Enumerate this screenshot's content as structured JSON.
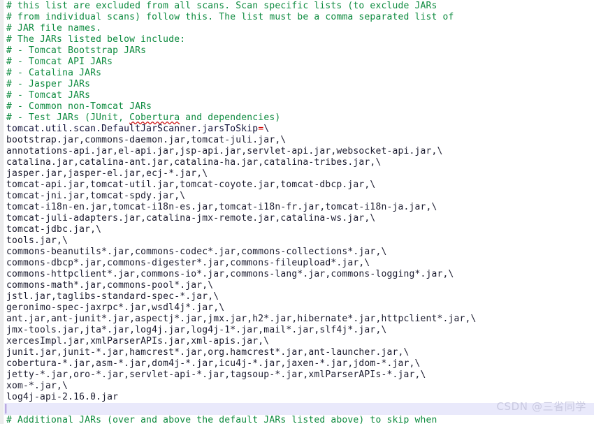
{
  "editor": {
    "file_type": "properties",
    "colors": {
      "background": "#ffffff",
      "gutter": "#ececed",
      "comment": "#0c8a3e",
      "text": "#101038",
      "operator": "#cc0000",
      "current_line": "#e9e9fb",
      "caret": "#6a3fb5",
      "spellcheck_underline": "#d01a1a",
      "watermark": "#c9c9e0"
    }
  },
  "watermark": {
    "text": "CSDN @三省同学"
  },
  "lines": [
    {
      "kind": "comment",
      "text": "# this list are excluded from all scans. Scan specific lists (to exclude JARs"
    },
    {
      "kind": "comment",
      "text": "# from individual scans) follow this. The list must be a comma separated list of"
    },
    {
      "kind": "comment",
      "text": "# JAR file names."
    },
    {
      "kind": "comment",
      "text": "# The JARs listed below include:"
    },
    {
      "kind": "comment",
      "text": "# - Tomcat Bootstrap JARs"
    },
    {
      "kind": "comment",
      "text": "# - Tomcat API JARs"
    },
    {
      "kind": "comment",
      "text": "# - Catalina JARs"
    },
    {
      "kind": "comment",
      "text": "# - Jasper JARs"
    },
    {
      "kind": "comment",
      "text": "# - Tomcat JARs"
    },
    {
      "kind": "comment",
      "text": "# - Common non-Tomcat JARs"
    },
    {
      "kind": "comment-spell",
      "pre": "# - Test JARs (JUnit, ",
      "spell": "Cobertura",
      "post": " and dependencies)"
    },
    {
      "kind": "key",
      "name": "tomcat.util.scan.DefaultJarScanner.jarsToSkip",
      "eq": "=",
      "cont": "\\"
    },
    {
      "kind": "value",
      "text": "bootstrap.jar,commons-daemon.jar,tomcat-juli.jar,\\"
    },
    {
      "kind": "value",
      "text": "annotations-api.jar,el-api.jar,jsp-api.jar,servlet-api.jar,websocket-api.jar,\\"
    },
    {
      "kind": "value",
      "text": "catalina.jar,catalina-ant.jar,catalina-ha.jar,catalina-tribes.jar,\\"
    },
    {
      "kind": "value",
      "text": "jasper.jar,jasper-el.jar,ecj-*.jar,\\"
    },
    {
      "kind": "value",
      "text": "tomcat-api.jar,tomcat-util.jar,tomcat-coyote.jar,tomcat-dbcp.jar,\\"
    },
    {
      "kind": "value",
      "text": "tomcat-jni.jar,tomcat-spdy.jar,\\"
    },
    {
      "kind": "value",
      "text": "tomcat-i18n-en.jar,tomcat-i18n-es.jar,tomcat-i18n-fr.jar,tomcat-i18n-ja.jar,\\"
    },
    {
      "kind": "value",
      "text": "tomcat-juli-adapters.jar,catalina-jmx-remote.jar,catalina-ws.jar,\\"
    },
    {
      "kind": "value",
      "text": "tomcat-jdbc.jar,\\"
    },
    {
      "kind": "value",
      "text": "tools.jar,\\"
    },
    {
      "kind": "value",
      "text": "commons-beanutils*.jar,commons-codec*.jar,commons-collections*.jar,\\"
    },
    {
      "kind": "value",
      "text": "commons-dbcp*.jar,commons-digester*.jar,commons-fileupload*.jar,\\"
    },
    {
      "kind": "value",
      "text": "commons-httpclient*.jar,commons-io*.jar,commons-lang*.jar,commons-logging*.jar,\\"
    },
    {
      "kind": "value",
      "text": "commons-math*.jar,commons-pool*.jar,\\"
    },
    {
      "kind": "value",
      "text": "jstl.jar,taglibs-standard-spec-*.jar,\\"
    },
    {
      "kind": "value",
      "text": "geronimo-spec-jaxrpc*.jar,wsdl4j*.jar,\\"
    },
    {
      "kind": "value",
      "text": "ant.jar,ant-junit*.jar,aspectj*.jar,jmx.jar,h2*.jar,hibernate*.jar,httpclient*.jar,\\"
    },
    {
      "kind": "value",
      "text": "jmx-tools.jar,jta*.jar,log4j.jar,log4j-1*.jar,mail*.jar,slf4j*.jar,\\"
    },
    {
      "kind": "value",
      "text": "xercesImpl.jar,xmlParserAPIs.jar,xml-apis.jar,\\"
    },
    {
      "kind": "value",
      "text": "junit.jar,junit-*.jar,hamcrest*.jar,org.hamcrest*.jar,ant-launcher.jar,\\"
    },
    {
      "kind": "value",
      "text": "cobertura-*.jar,asm-*.jar,dom4j-*.jar,icu4j-*.jar,jaxen-*.jar,jdom-*.jar,\\"
    },
    {
      "kind": "value",
      "text": "jetty-*.jar,oro-*.jar,servlet-api-*.jar,tagsoup-*.jar,xmlParserAPIs-*.jar,\\"
    },
    {
      "kind": "value",
      "text": "xom-*.jar,\\"
    },
    {
      "kind": "value",
      "text": "log4j-api-2.16.0.jar"
    },
    {
      "kind": "current",
      "text": ""
    },
    {
      "kind": "comment",
      "text": "# Additional JARs (over and above the default JARs listed above) to skip when"
    }
  ]
}
